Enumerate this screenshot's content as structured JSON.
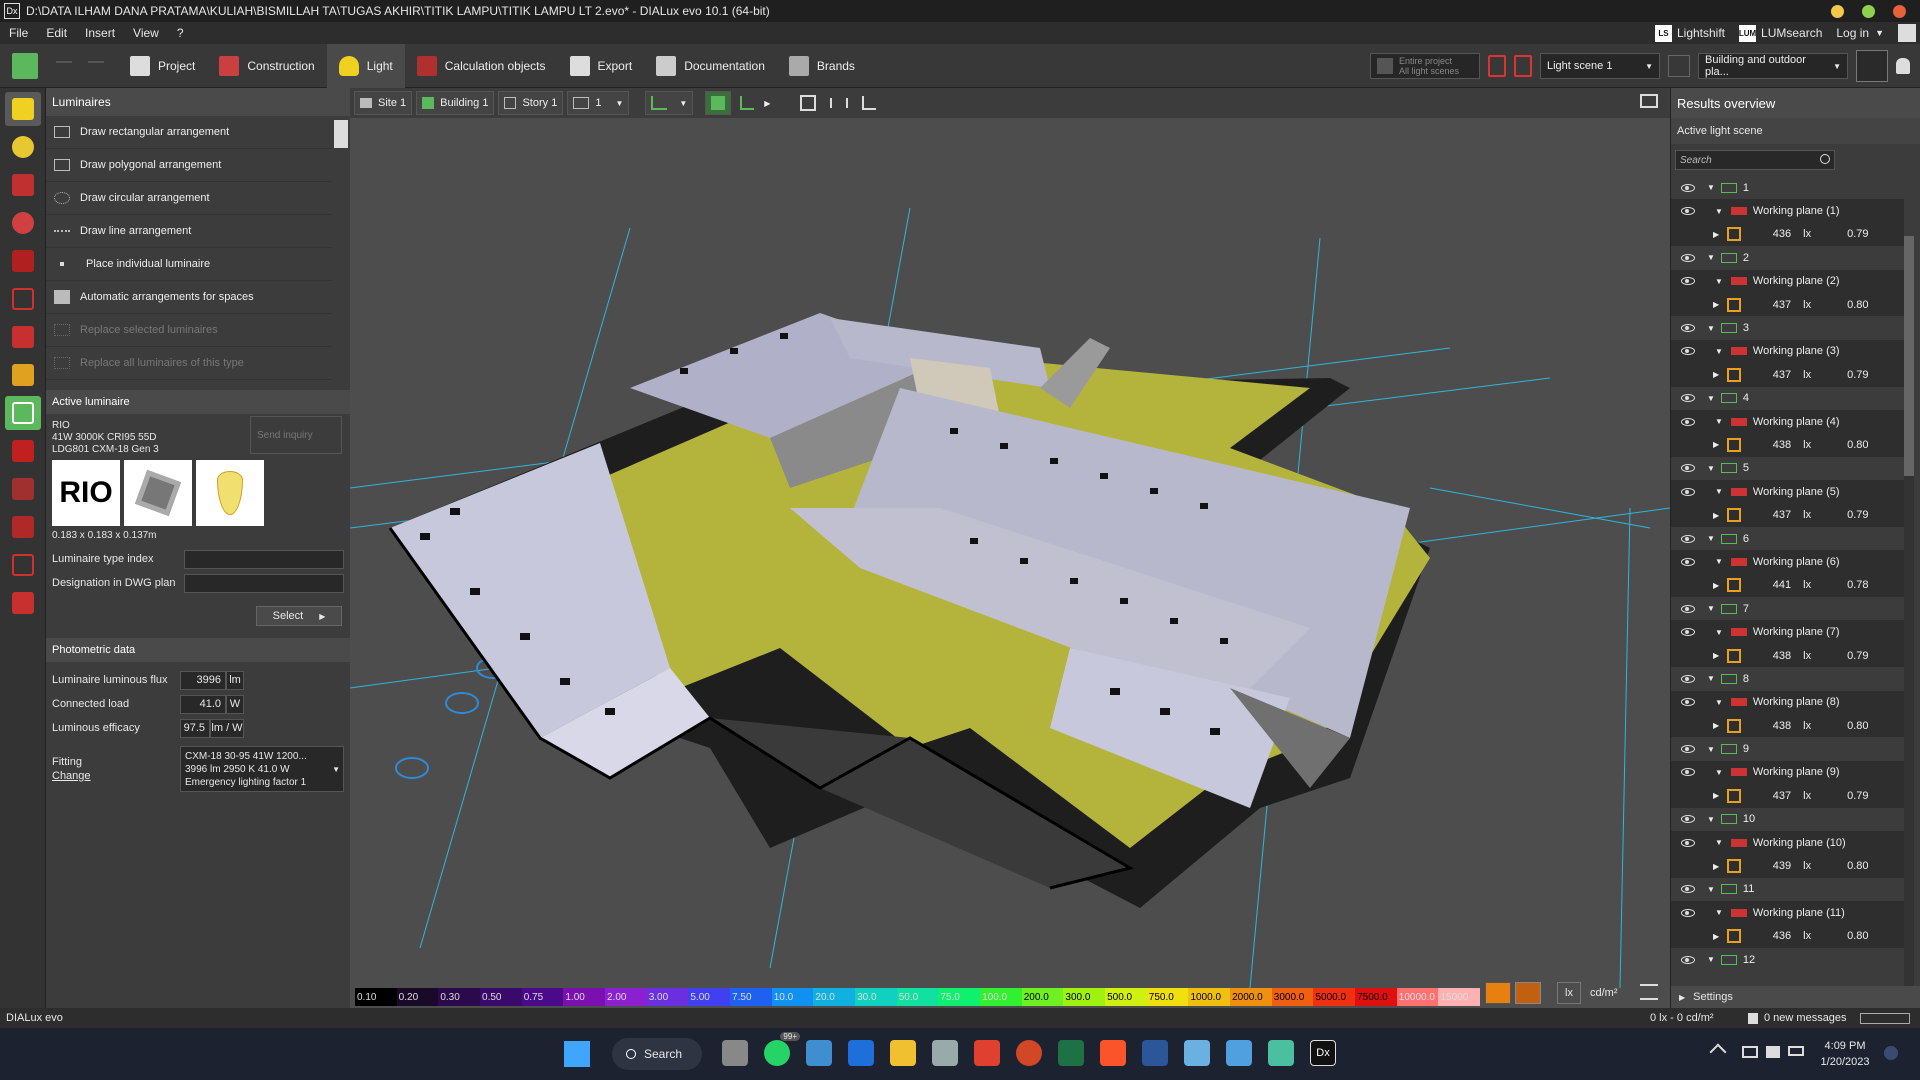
{
  "window": {
    "title": "D:\\DATA ILHAM DANA PRATAMA\\KULIAH\\BISMILLAH TA\\TUGAS AKHIR\\TITIK LAMPU\\TITIK LAMPU LT 2.evo* - DIALux evo 10.1  (64-bit)",
    "icon": "Dx"
  },
  "menu": [
    "File",
    "Edit",
    "Insert",
    "View",
    "?"
  ],
  "menu_right": {
    "lightshift": "Lightshift",
    "lumsearch": "LUMsearch",
    "login": "Log in"
  },
  "toolbar": {
    "items": [
      "Project",
      "Construction",
      "Light",
      "Calculation objects",
      "Export",
      "Documentation",
      "Brands"
    ],
    "active": "Light",
    "entire_project": "Entire project",
    "all_scenes": "All light scenes",
    "light_scene": "Light scene 1",
    "building_dd": "Building and outdoor pla..."
  },
  "left_panel": {
    "title": "Luminaires",
    "items": [
      {
        "label": "Draw rectangular arrangement",
        "disabled": false
      },
      {
        "label": "Draw polygonal arrangement",
        "disabled": false
      },
      {
        "label": "Draw circular arrangement",
        "disabled": false
      },
      {
        "label": "Draw line arrangement",
        "disabled": false
      },
      {
        "label": "Place individual luminaire",
        "disabled": false
      },
      {
        "label": "Automatic arrangements for spaces",
        "disabled": false
      },
      {
        "label": "Replace selected luminaires",
        "disabled": true
      },
      {
        "label": "Replace all luminaires of this type",
        "disabled": true
      }
    ],
    "active_luminaire": {
      "title": "Active luminaire",
      "brand": "RIO",
      "line1": "41W 3000K CRI95 55D",
      "line2": "LDG801 CXM-18 Gen 3",
      "send_inquiry": "Send inquiry",
      "logo": "RIO",
      "dims": "0.183 x 0.183 x 0.137m",
      "type_index_label": "Luminaire type index",
      "dwg_label": "Designation in DWG plan",
      "select": "Select"
    },
    "photometric": {
      "title": "Photometric data",
      "flux_label": "Luminaire luminous flux",
      "flux": "3996",
      "flux_unit": "lm",
      "load_label": "Connected load",
      "load": "41.0",
      "load_unit": "W",
      "efficacy_label": "Luminous efficacy",
      "efficacy": "97.5",
      "efficacy_unit": "lm / W",
      "fitting_label": "Fitting",
      "change": "Change",
      "fitting_l1": "CXM-18 30-95 41W 1200...",
      "fitting_l2": "3996 lm   2950 K   41.0 W",
      "fitting_l3": "Emergency lighting factor  1"
    }
  },
  "view_toolbar": {
    "site": "Site 1",
    "building": "Building 1",
    "story": "Story 1",
    "level": "1"
  },
  "scale": {
    "values": [
      "0.10",
      "0.20",
      "0.30",
      "0.50",
      "0.75",
      "1.00",
      "2.00",
      "3.00",
      "5.00",
      "7.50",
      "10.0",
      "20.0",
      "30.0",
      "50.0",
      "75.0",
      "100.0",
      "200.0",
      "300.0",
      "500.0",
      "750.0",
      "1000.0",
      "2000.0",
      "3000.0",
      "5000.0",
      "7500.0",
      "10000.0",
      "15000"
    ],
    "colors": [
      "#000000",
      "#1a0a2a",
      "#2a0a4a",
      "#3a0a6a",
      "#4a0a8a",
      "#7a10b0",
      "#8a20d0",
      "#6a30e0",
      "#4040f0",
      "#2060f0",
      "#1090f0",
      "#10b0e0",
      "#10d0c0",
      "#10e0a0",
      "#10f070",
      "#30f030",
      "#70f020",
      "#a0f010",
      "#d0f010",
      "#f0e010",
      "#f0c010",
      "#f09010",
      "#f06010",
      "#f03010",
      "#e01010",
      "#ff7070",
      "#ffb0b0"
    ],
    "unit_lx": "lx",
    "unit_cd": "cd/m²"
  },
  "results": {
    "title": "Results overview",
    "active_scene": "Active light scene",
    "search": "Search",
    "items": [
      {
        "n": "1",
        "plane": "Working plane (1)",
        "lx": "436",
        "u": "0.79"
      },
      {
        "n": "2",
        "plane": "Working plane (2)",
        "lx": "437",
        "u": "0.80"
      },
      {
        "n": "3",
        "plane": "Working plane (3)",
        "lx": "437",
        "u": "0.79"
      },
      {
        "n": "4",
        "plane": "Working plane (4)",
        "lx": "438",
        "u": "0.80"
      },
      {
        "n": "5",
        "plane": "Working plane (5)",
        "lx": "437",
        "u": "0.79"
      },
      {
        "n": "6",
        "plane": "Working plane (6)",
        "lx": "441",
        "u": "0.78"
      },
      {
        "n": "7",
        "plane": "Working plane (7)",
        "lx": "438",
        "u": "0.79"
      },
      {
        "n": "8",
        "plane": "Working plane (8)",
        "lx": "438",
        "u": "0.80"
      },
      {
        "n": "9",
        "plane": "Working plane (9)",
        "lx": "437",
        "u": "0.79"
      },
      {
        "n": "10",
        "plane": "Working plane (10)",
        "lx": "439",
        "u": "0.80"
      },
      {
        "n": "11",
        "plane": "Working plane (11)",
        "lx": "436",
        "u": "0.80"
      },
      {
        "n": "12"
      }
    ],
    "lx_unit": "lx",
    "settings": "Settings"
  },
  "status": {
    "brand": "DIALux evo",
    "readout": "0 lx - 0 cd/m²",
    "messages": "0 new messages"
  },
  "taskbar": {
    "search": "Search",
    "time": "4:09 PM",
    "date": "1/20/2023",
    "badge": "99+",
    "apps": [
      "task-view",
      "whatsapp",
      "notepad",
      "defender",
      "explorer",
      "settings",
      "pdf",
      "powerpoint",
      "excel",
      "brave",
      "word",
      "pin1",
      "pin2",
      "photos",
      "dialux"
    ]
  },
  "colors": {
    "accent_blue": "#2e8bd8",
    "floor_yellow": "#b4b43c",
    "grid_cyan": "#2ad0ff"
  }
}
